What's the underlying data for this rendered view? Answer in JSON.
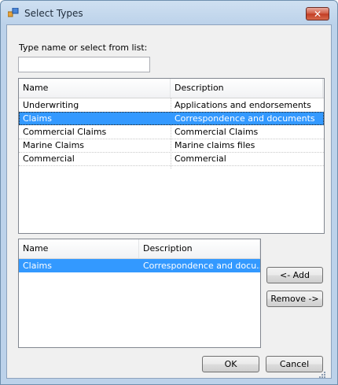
{
  "window": {
    "title": "Select Types",
    "close_glyph": "✕"
  },
  "prompt_label": "Type name or select from list:",
  "search_input": {
    "value": "",
    "placeholder": ""
  },
  "available_list": {
    "columns": [
      "Name",
      "Description"
    ],
    "rows": [
      {
        "name": "Underwriting",
        "description": "Applications and endorsements",
        "selected": false
      },
      {
        "name": "Claims",
        "description": "Correspondence and documents",
        "selected": true
      },
      {
        "name": "Commercial Claims",
        "description": "Commercial Claims",
        "selected": false
      },
      {
        "name": "Marine Claims",
        "description": "Marine claims files",
        "selected": false
      },
      {
        "name": "Commercial",
        "description": "Commercial",
        "selected": false
      }
    ]
  },
  "selected_list": {
    "columns": [
      "Name",
      "Description"
    ],
    "rows": [
      {
        "name": "Claims",
        "description": "Correspondence and docu...",
        "selected": true
      }
    ]
  },
  "buttons": {
    "add": "<- Add",
    "remove": "Remove ->",
    "ok": "OK",
    "cancel": "Cancel"
  },
  "colors": {
    "selection": "#3399ff",
    "window_frame": "#bcd2ea",
    "close_button": "#c23b22"
  }
}
